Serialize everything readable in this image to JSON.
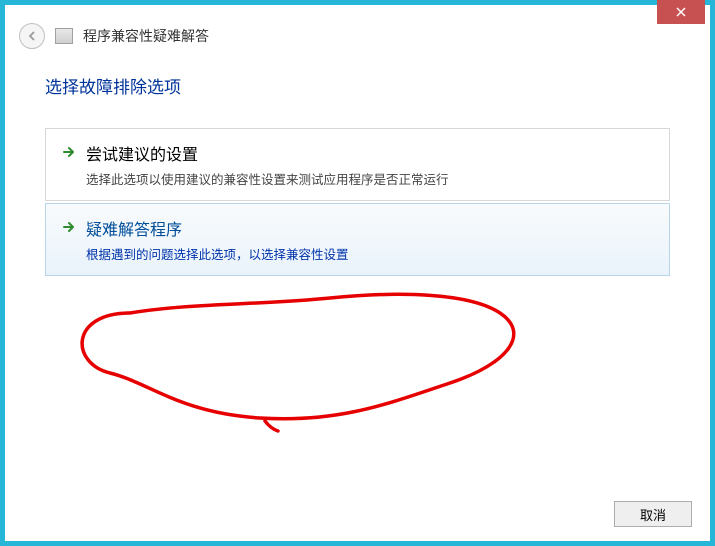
{
  "header": {
    "title": "程序兼容性疑难解答"
  },
  "content": {
    "section_title": "选择故障排除选项",
    "options": [
      {
        "title": "尝试建议的设置",
        "desc": "选择此选项以使用建议的兼容性设置来测试应用程序是否正常运行"
      },
      {
        "title": "疑难解答程序",
        "desc": "根据遇到的问题选择此选项，以选择兼容性设置"
      }
    ]
  },
  "footer": {
    "cancel_label": "取消"
  }
}
